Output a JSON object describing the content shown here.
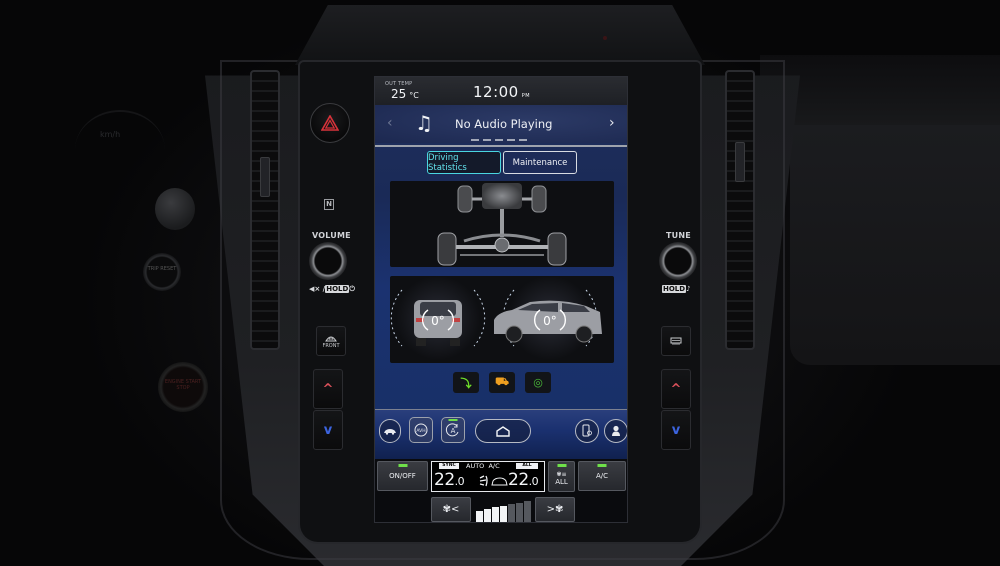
{
  "dashboard": {
    "cluster_text": "km/h",
    "trip_button": "TRIP RESET",
    "engine_button": "ENGINE START STOP"
  },
  "controls": {
    "volume_label": "VOLUME",
    "volume_sub": "◀× /",
    "volume_hold": "HOLD",
    "volume_power": "⏻",
    "tune_label": "TUNE",
    "tune_hold": "HOLD",
    "tune_sub": "♪",
    "front_defrost_label": "FRONT",
    "nfc": "N",
    "up": "^",
    "down": "v",
    "colors": {
      "hazard": "#d8323a",
      "temp_up": "#d8505a",
      "temp_down": "#3c64e0"
    }
  },
  "status": {
    "out_temp_label": "OUT TEMP",
    "out_temp_value": "25",
    "out_temp_unit": "°C",
    "time": "12:00",
    "ampm": "PM"
  },
  "audio": {
    "title": "No Audio Playing",
    "prev": "‹",
    "next": "›",
    "music_icon": "♫",
    "page_count": 5
  },
  "tabs": [
    {
      "label": "Driving Statistics",
      "active": true
    },
    {
      "label": "Maintenance",
      "active": false
    }
  ],
  "tilt": {
    "roll_angle": "0°",
    "pitch_angle": "0°"
  },
  "alert_icons": [
    {
      "name": "hill-descent-icon",
      "glyph": "⤵",
      "color": "#6fe02a"
    },
    {
      "name": "vehicle-dynamics-icon",
      "glyph": "⛟",
      "color": "#f0a020"
    },
    {
      "name": "vdc-off-icon",
      "glyph": "◎",
      "color": "#4cc03a"
    }
  ],
  "nav": {
    "car_icon": "🚘",
    "auto_hold_label": "(A)",
    "auto_stop_label": "Ⓐ",
    "home_icon": "⌂",
    "phone_icon": "📱",
    "profile_icon": "👤"
  },
  "climate": {
    "on_off_label": "ON/OFF",
    "sync_label": "SYNC",
    "all_tag": "ALL",
    "auto_label": "AUTO",
    "ac_mode_label": "A/C",
    "temp_left": "22",
    "temp_left_dec": ".0",
    "temp_right": "22",
    "temp_right_dec": ".0",
    "airflow_glyph": "⇢⛍",
    "fan_all_label": "ALL",
    "fan_all_icon": "✾≡",
    "ac_label": "A/C",
    "fan_down_label": "✾<",
    "fan_up_label": ">✾",
    "fan_level": 4,
    "fan_max": 7,
    "led_color": "#6fe04a"
  }
}
